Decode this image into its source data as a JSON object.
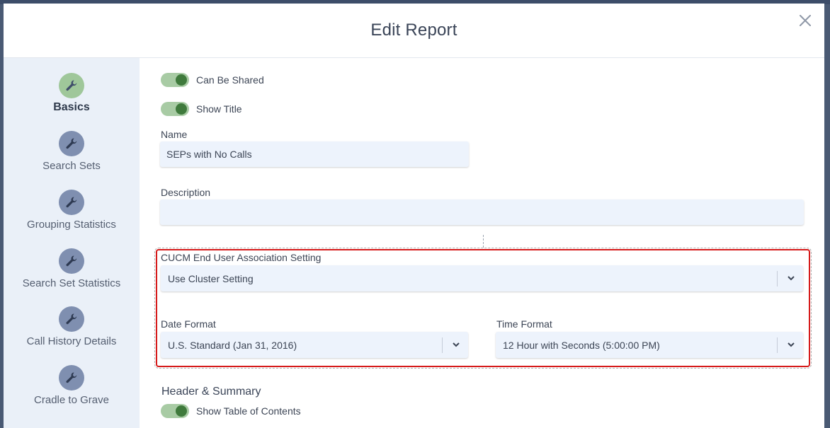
{
  "modal": {
    "title": "Edit Report"
  },
  "sidebar": {
    "items": [
      {
        "label": "Basics",
        "icon": "wrench-icon",
        "active": true
      },
      {
        "label": "Search Sets",
        "icon": "wrench-icon"
      },
      {
        "label": "Grouping Statistics",
        "icon": "wrench-icon"
      },
      {
        "label": "Search Set Statistics",
        "icon": "wrench-icon"
      },
      {
        "label": "Call History Details",
        "icon": "wrench-icon"
      },
      {
        "label": "Cradle to Grave",
        "icon": "wrench-icon"
      }
    ]
  },
  "form": {
    "can_be_shared": {
      "label": "Can Be Shared",
      "on": true
    },
    "show_title": {
      "label": "Show Title",
      "on": true
    },
    "name": {
      "label": "Name",
      "value": "SEPs with No Calls"
    },
    "description": {
      "label": "Description",
      "value": ""
    },
    "cucm": {
      "label": "CUCM End User Association Setting",
      "value": "Use Cluster Setting"
    },
    "date_format": {
      "label": "Date Format",
      "value": "U.S. Standard (Jan 31, 2016)"
    },
    "time_format": {
      "label": "Time Format",
      "value": "12 Hour with Seconds (5:00:00 PM)"
    },
    "header_summary": {
      "title": "Header & Summary"
    },
    "show_toc": {
      "label": "Show Table of Contents",
      "on": true
    }
  },
  "colors": {
    "toggle_track": "#a8cba4",
    "toggle_knob": "#3f7a3c",
    "active_icon": "#9fc79a",
    "inactive_icon": "#7f8fb0",
    "sidebar_bg": "#eaf0f8",
    "input_bg": "#edf3fc",
    "highlight": "#d61a1a"
  }
}
